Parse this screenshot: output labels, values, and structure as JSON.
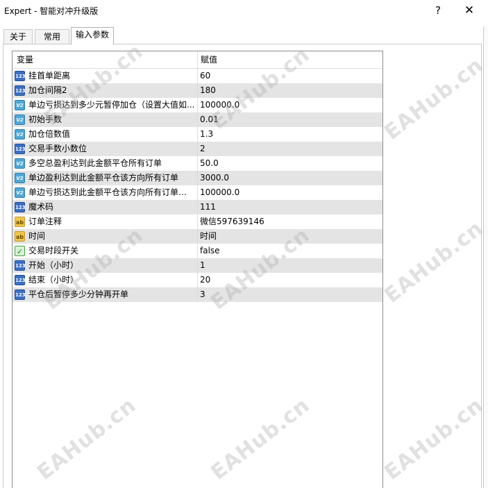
{
  "window": {
    "title": "Expert - 智能对冲升级版",
    "help_label": "?",
    "close_label": "✕"
  },
  "tabs": [
    {
      "label": "关于",
      "active": false
    },
    {
      "label": "常用",
      "active": false
    },
    {
      "label": "输入参数",
      "active": true
    }
  ],
  "grid": {
    "header_variable": "变量",
    "header_value": "赋值",
    "rows": [
      {
        "type": "int",
        "icon": "123",
        "name": "挂首单距离",
        "value": "60"
      },
      {
        "type": "int",
        "icon": "123",
        "name": "加仓间隔2",
        "value": "180"
      },
      {
        "type": "double",
        "icon": "V2",
        "name": "单边亏损达到多少元暂停加仓（设置大值如...",
        "value": "100000.0"
      },
      {
        "type": "double",
        "icon": "V2",
        "name": "初始手数",
        "value": "0.01"
      },
      {
        "type": "double",
        "icon": "V2",
        "name": "加仓倍数值",
        "value": "1.3"
      },
      {
        "type": "int",
        "icon": "123",
        "name": "交易手数小数位",
        "value": "2"
      },
      {
        "type": "double",
        "icon": "V2",
        "name": "多空总盈利达到此金额平仓所有订单",
        "value": "50.0"
      },
      {
        "type": "double",
        "icon": "V2",
        "name": "单边盈利达到此金额平仓该方向所有订单",
        "value": "3000.0"
      },
      {
        "type": "double",
        "icon": "V2",
        "name": "单边亏损达到此金额平仓该方向所有订单（?...",
        "value": "100000.0"
      },
      {
        "type": "int",
        "icon": "123",
        "name": "魔术码",
        "value": "111"
      },
      {
        "type": "string",
        "icon": "ab",
        "name": "订单注释",
        "value": "微信597639146"
      },
      {
        "type": "string",
        "icon": "ab",
        "name": "时间",
        "value": "时间"
      },
      {
        "type": "bool",
        "icon": "✓",
        "name": "交易时段开关",
        "value": "false"
      },
      {
        "type": "int",
        "icon": "123",
        "name": "开始（小时）",
        "value": "1"
      },
      {
        "type": "int",
        "icon": "123",
        "name": "结束（小时）",
        "value": "20"
      },
      {
        "type": "int",
        "icon": "123",
        "name": "平仓后暂停多少分钟再开单",
        "value": "3"
      }
    ]
  },
  "watermark": "EAHub.cn"
}
